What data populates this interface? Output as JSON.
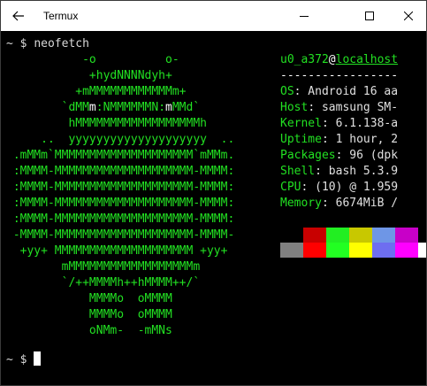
{
  "window": {
    "title": "Termux"
  },
  "terminal": {
    "prompt1": "~ $ ",
    "command1": "neofetch",
    "prompt2": "~ $ ",
    "logo": [
      "           -o          o-",
      "            +hydNNNNdyh+",
      "          +mMMMMMMMMMMMMm+",
      "        `dMM",
      "         hMMMMMMMMMMMMMMMMMMh",
      "     ..  yyyyyyyyyyyyyyyyyyyy  ..",
      " .mMMm`MMMMMMMMMMMMMMMMMMMM`mMMm.",
      " :MMMM-MMMMMMMMMMMMMMMMMMMM-MMMM:",
      " :MMMM-MMMMMMMMMMMMMMMMMMMM-MMMM:",
      " :MMMM-MMMMMMMMMMMMMMMMMMMM-MMMM:",
      " :MMMM-MMMMMMMMMMMMMMMMMMMM-MMMM:",
      " -MMMM-MMMMMMMMMMMMMMMMMMMM-MMMM-",
      "  +yy+ MMMMMMMMMMMMMMMMMMMM +yy+",
      "        mMMMMMMMMMMMMMMMMMMm",
      "        `/++MMMMh++hMMMM++/`",
      "            MMMMo  oMMMM",
      "            MMMMo  oMMMM",
      "            oNMm-  -mMNs"
    ],
    "logo_eyes": {
      "pre": "        `dMM",
      "m1": "m",
      "mid": ":NMMMMMMN:",
      "m2": "m",
      "post": "MMd`"
    },
    "info": {
      "user": "u0_a372",
      "at": "@",
      "host": "localhost",
      "separator": "-----------------",
      "rows": [
        {
          "key": "OS",
          "value": ": Android 16 aa"
        },
        {
          "key": "Host",
          "value": ": samsung SM-"
        },
        {
          "key": "Kernel",
          "value": ": 6.1.138-a"
        },
        {
          "key": "Uptime",
          "value": ": 1 hour, 2"
        },
        {
          "key": "Packages",
          "value": ": 96 (dpk"
        },
        {
          "key": "Shell",
          "value": ": bash 5.3.9"
        },
        {
          "key": "CPU",
          "value": ": (10) @ 1.959"
        },
        {
          "key": "Memory",
          "value": ": 6674MiB /"
        }
      ],
      "palette_top": [
        "#000000",
        "#c80000",
        "#22ee22",
        "#c8c800",
        "#6e96e6",
        "#c800c8",
        "#000000"
      ],
      "palette_bottom": [
        "#808080",
        "#ff0000",
        "#22ff22",
        "#ffff00",
        "#6e6ef0",
        "#ff00ff",
        "#ffffff"
      ]
    }
  }
}
